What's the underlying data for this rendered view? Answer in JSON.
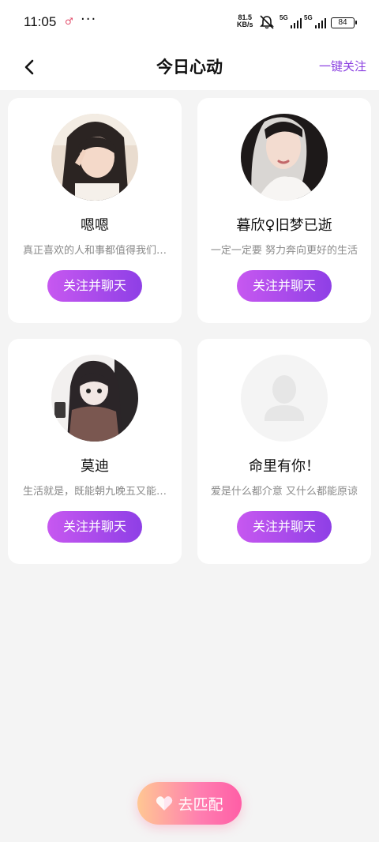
{
  "status_bar": {
    "time": "11:05",
    "dots": "···",
    "speed_value": "81.5",
    "speed_unit": "KB/s",
    "sim1_tag": "5G",
    "sim2_tag": "5G",
    "battery": "84"
  },
  "navbar": {
    "title": "今日心动",
    "follow_all": "一键关注"
  },
  "cards": [
    {
      "name": "嗯嗯",
      "bio": "真正喜欢的人和事都值得我们…",
      "button": "关注并聊天",
      "avatar": "photo"
    },
    {
      "name": "暮欣♀旧梦已逝",
      "bio": "一定一定要 努力奔向更好的生活",
      "button": "关注并聊天",
      "avatar": "photo"
    },
    {
      "name": "莫迪",
      "bio": "生活就是，既能朝九晚五又能…",
      "button": "关注并聊天",
      "avatar": "illustration"
    },
    {
      "name": "命里有你！",
      "bio": "爱是什么都介意 又什么都能原谅",
      "button": "关注并聊天",
      "avatar": "placeholder-person-icon"
    }
  ],
  "match_button": {
    "label": "去匹配",
    "icon": "heart-icon"
  },
  "colors": {
    "accent": "#8a3fe0",
    "button_gradient": [
      "#c758f0",
      "#8e3fe6"
    ],
    "match_gradient": [
      "#ffc793",
      "#ff5ea6"
    ]
  }
}
